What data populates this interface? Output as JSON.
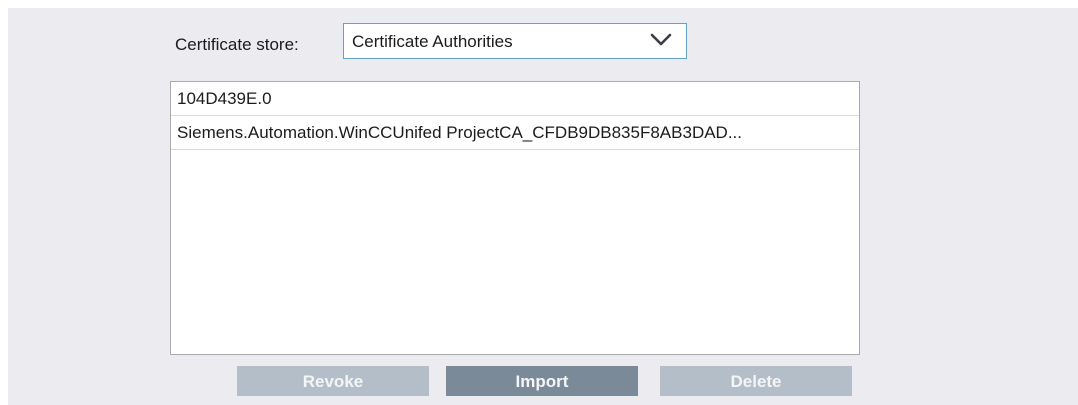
{
  "certificate_store": {
    "label": "Certificate store:",
    "selected": "Certificate Authorities",
    "icon": "chevron-down-icon"
  },
  "certificates": [
    "104D439E.0",
    "Siemens.Automation.WinCCUnifed ProjectCA_CFDB9DB835F8AB3DAD..."
  ],
  "buttons": {
    "revoke_label": "Revoke",
    "import_label": "Import",
    "delete_label": "Delete"
  },
  "colors": {
    "panel_background": "#ebebf0",
    "select_border": "#5ea5c2",
    "button_disabled": "#b4bec8",
    "button_active": "#7a8a99"
  }
}
